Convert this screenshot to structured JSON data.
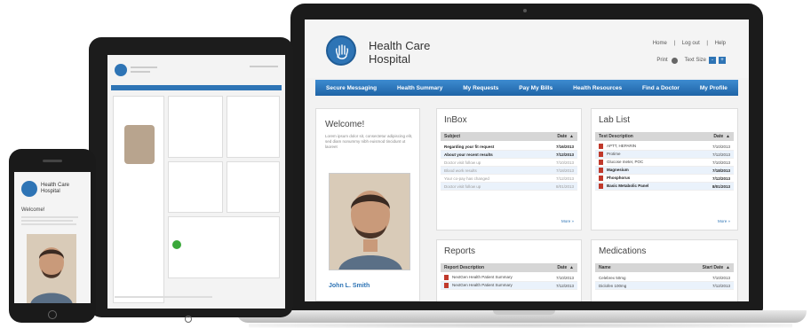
{
  "brand": {
    "line1": "Health Care",
    "line2": "Hospital"
  },
  "top_links": {
    "home": "Home",
    "logout": "Log out",
    "help": "Help",
    "print": "Print",
    "text_size": "Text Size",
    "minus": "-",
    "plus": "+",
    "sep": "|"
  },
  "nav": [
    "Secure Messaging",
    "Health Summary",
    "My Requests",
    "Pay My Bills",
    "Health Resources",
    "Find a Doctor",
    "My Profile"
  ],
  "sidebar": {
    "welcome": "Welcome!",
    "intro": "Lorem ipsum dolor sit, consectetur adipiscing elit, sed diam nonummy nibh euismod tincidunt ut laoreet",
    "patient_name": "John L. Smith"
  },
  "inbox": {
    "title": "InBox",
    "col_subject": "Subject",
    "col_date": "Date",
    "sort_icon": "▲",
    "rows": [
      {
        "subject": "Regarding your fit request",
        "date": "7/16/2013"
      },
      {
        "subject": "About your recent results",
        "date": "7/12/2013"
      },
      {
        "subject": "Doctor visit follow up",
        "date": "7/10/2013"
      },
      {
        "subject": "Blood work results",
        "date": "7/18/2013"
      },
      {
        "subject": "Your co-pay has changed",
        "date": "7/12/2013"
      },
      {
        "subject": "Doctor visit follow up",
        "date": "8/01/2013"
      }
    ],
    "more": "More »"
  },
  "lablist": {
    "title": "Lab List",
    "col_desc": "Test Description",
    "col_date": "Date",
    "sort_icon": "▲",
    "rows": [
      {
        "name": "APTT, HEPARIN",
        "date": "7/10/2013"
      },
      {
        "name": "Protime",
        "date": "7/12/2013"
      },
      {
        "name": "Glucose meter, POC",
        "date": "7/10/2013"
      },
      {
        "name": "Magnesium",
        "date": "7/18/2013"
      },
      {
        "name": "Phosphorus",
        "date": "7/12/2013"
      },
      {
        "name": "Basic Metabolic Panel",
        "date": "8/01/2013"
      }
    ],
    "more": "More »"
  },
  "reports": {
    "title": "Reports",
    "col_desc": "Report Description",
    "col_date": "Date",
    "sort_icon": "▲",
    "rows": [
      {
        "name": "NextGen Health Patient Summary",
        "date": "7/10/2013"
      },
      {
        "name": "NextGen Health Patient Summary",
        "date": "7/12/2013"
      }
    ]
  },
  "medications": {
    "title": "Medications",
    "col_name": "Name",
    "col_date": "Start Date",
    "sort_icon": "▲",
    "rows": [
      {
        "name": "Celebrex 50mg",
        "date": "7/10/2013"
      },
      {
        "name": "Diclofen 100mg",
        "date": "7/12/2013"
      }
    ]
  },
  "colors": {
    "accent": "#2e74b5",
    "nav_top": "#3d8bd0",
    "nav_bottom": "#1f64a6",
    "pdf": "#c0392b"
  },
  "icons": [
    "hand-logo-icon",
    "gear-icon",
    "pdf-icon",
    "sort-arrow-icon"
  ]
}
